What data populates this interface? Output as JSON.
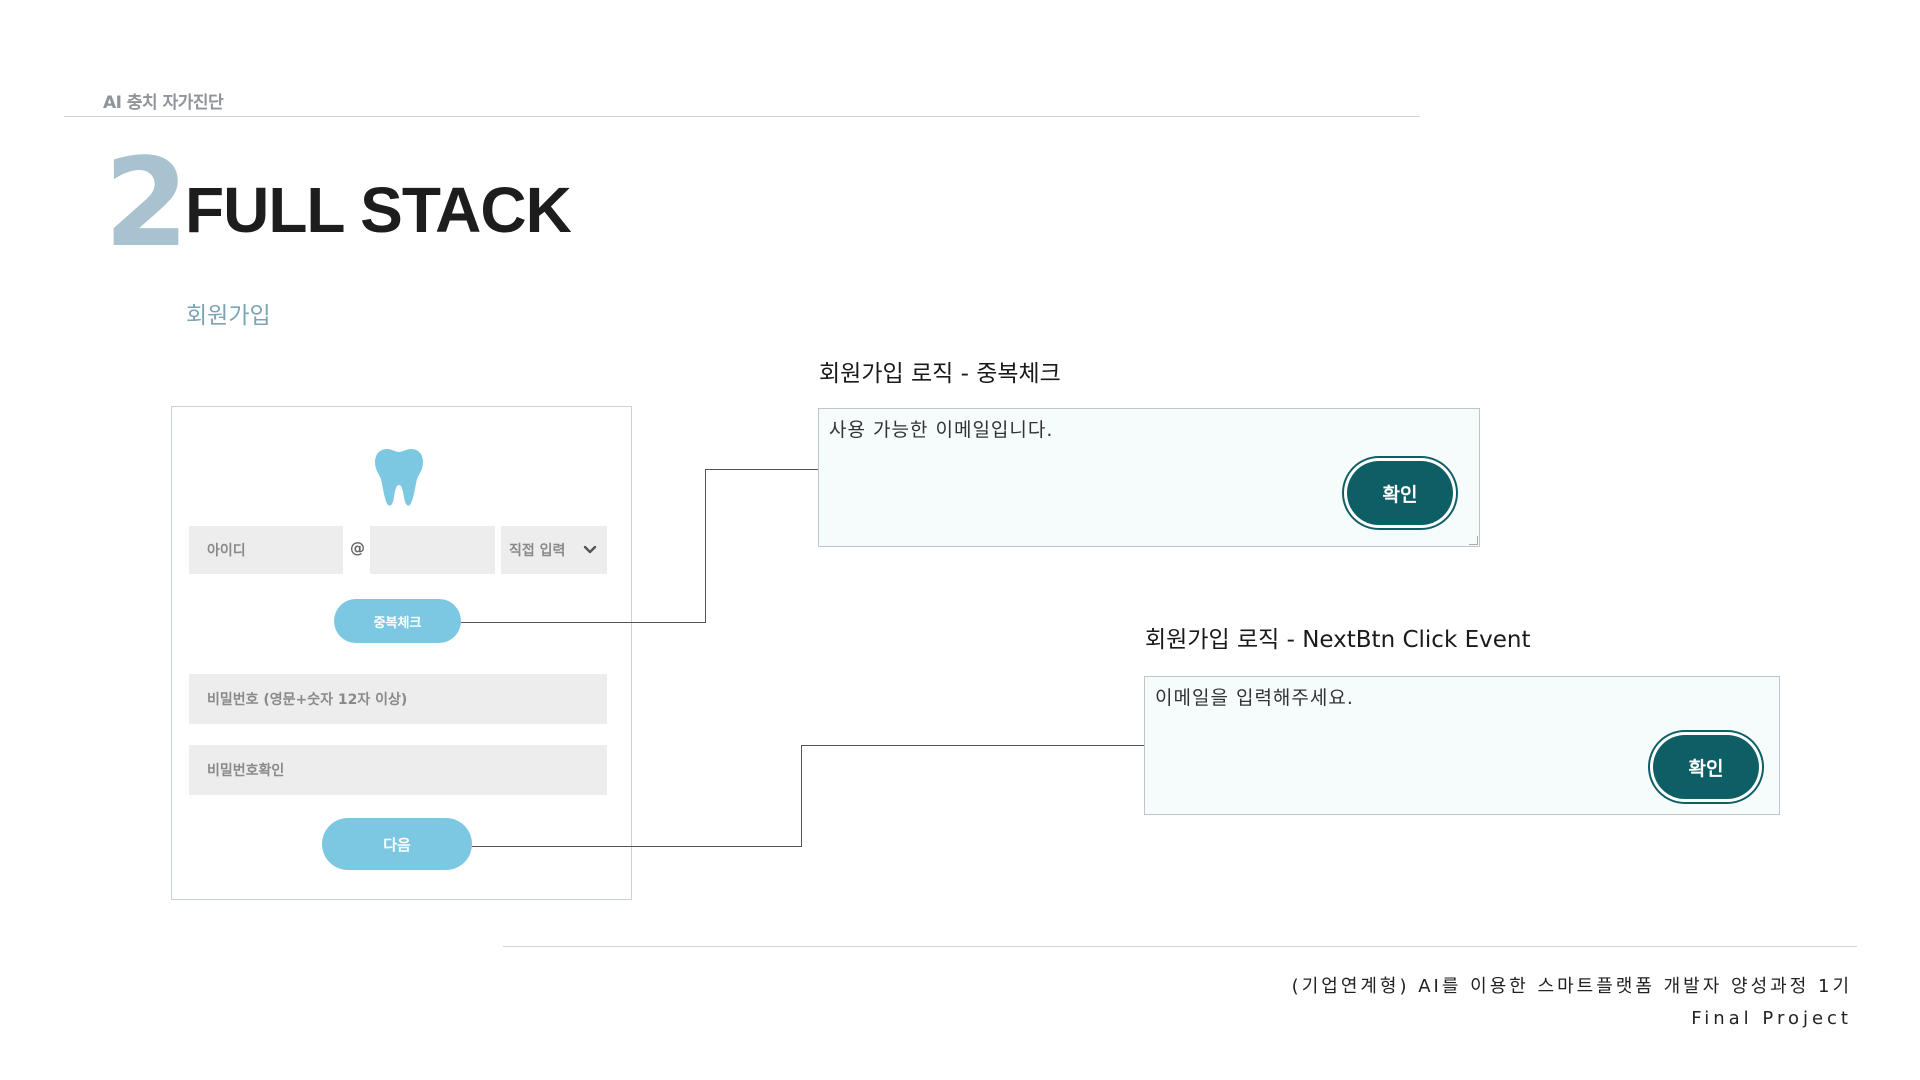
{
  "header": {
    "project_label": "AI 충치 자가진단",
    "section_number": "2",
    "section_title": "FULL STACK",
    "subsection": "회원가입"
  },
  "form": {
    "id_placeholder": "아이디",
    "at": "@",
    "domain_placeholder": "",
    "domain_select": "직접 입력",
    "duplicate_check_label": "중복체크",
    "password_placeholder": "비밀번호 (영문+숫자 12자 이상)",
    "password_confirm_placeholder": "비밀번호확인",
    "next_label": "다음"
  },
  "panels": [
    {
      "title": "회원가입 로직 - 중복체크",
      "message": "사용 가능한 이메일입니다.",
      "button": "확인"
    },
    {
      "title": "회원가입 로직 - NextBtn Click Event",
      "message": "이메일을 입력해주세요.",
      "button": "확인"
    }
  ],
  "footer": {
    "course": "(기업연계형) AI를 이용한 스마트플랫폼 개발자 양성과정 1기",
    "project": "Final Project"
  },
  "colors": {
    "accent_light": "#7cc8e2",
    "accent_dark": "#0e5e66",
    "section_number": "#a8c3cf",
    "subsection": "#7aa5b6"
  },
  "icons": {
    "logo": "tooth-icon",
    "select": "chevron-down-icon"
  }
}
